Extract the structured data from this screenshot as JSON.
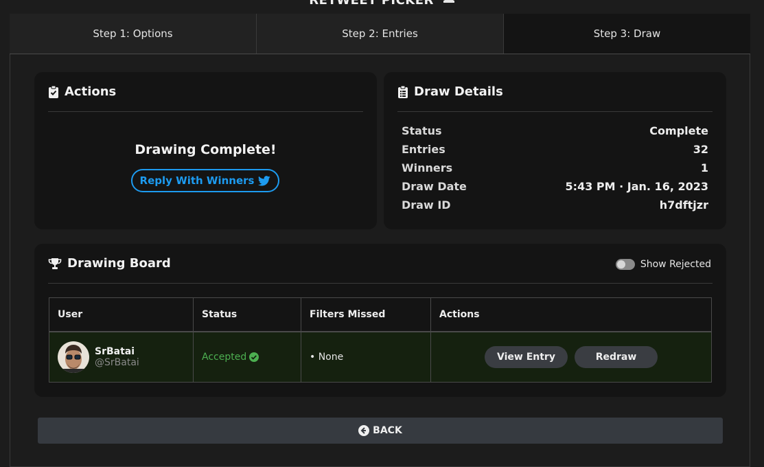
{
  "app": {
    "title": "RETWEET PICKER",
    "title_icon": "ticket-icon"
  },
  "tabs": [
    {
      "label": "Step 1: Options",
      "active": false
    },
    {
      "label": "Step 2: Entries",
      "active": false
    },
    {
      "label": "Step 3: Draw",
      "active": true
    }
  ],
  "actions": {
    "title": "Actions",
    "icon": "clipboard-check-icon",
    "message": "Drawing Complete!",
    "reply_button": "Reply With Winners",
    "reply_icon": "twitter-icon",
    "accent": "#1d9bf0"
  },
  "details": {
    "title": "Draw Details",
    "icon": "clipboard-list-icon",
    "rows": [
      {
        "label": "Status",
        "value": "Complete"
      },
      {
        "label": "Entries",
        "value": "32"
      },
      {
        "label": "Winners",
        "value": "1"
      },
      {
        "label": "Draw Date",
        "value": "5:43 PM · Jan. 16, 2023"
      },
      {
        "label": "Draw ID",
        "value": "h7dftjzr"
      }
    ]
  },
  "board": {
    "title": "Drawing Board",
    "icon": "trophy-icon",
    "toggle_label": "Show Rejected",
    "toggle_on": false,
    "columns": [
      "User",
      "Status",
      "Filters Missed",
      "Actions"
    ],
    "rows": [
      {
        "name": "SrBatai",
        "handle": "@SrBatai",
        "status": "Accepted",
        "status_color": "#4caf50",
        "filters_missed": "• None",
        "view_button": "View Entry",
        "redraw_button": "Redraw"
      }
    ]
  },
  "back_button": "BACK"
}
